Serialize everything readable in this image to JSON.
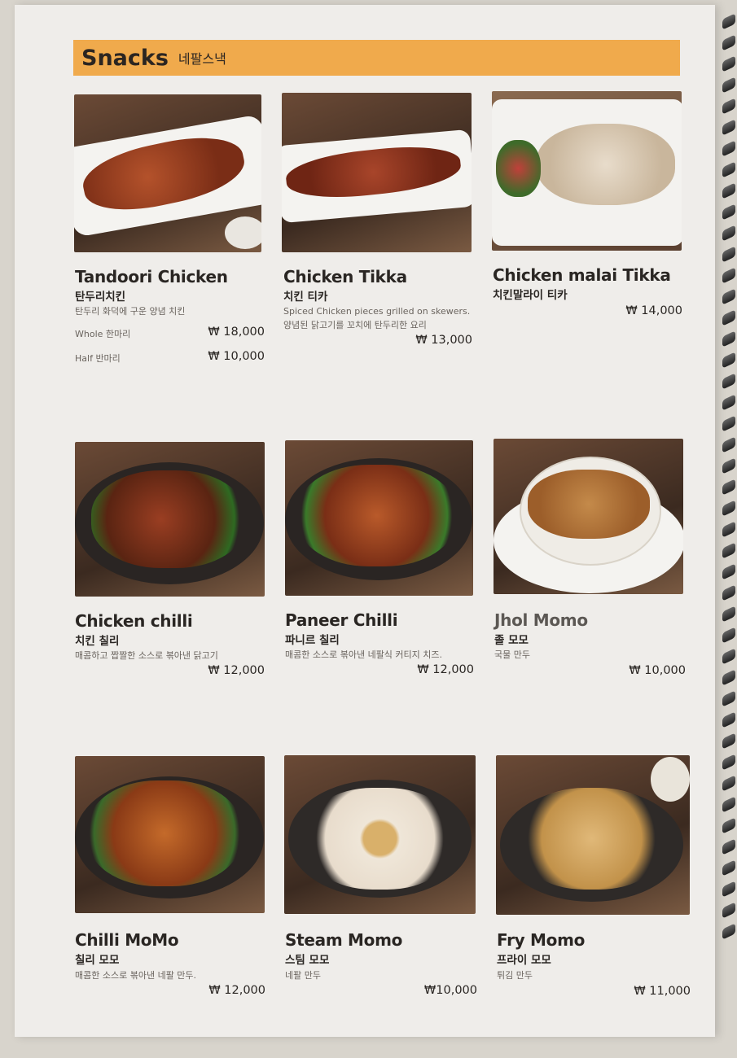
{
  "section": {
    "title": "Snacks",
    "subtitle": "네팔스낵"
  },
  "items": [
    {
      "name": "Tandoori Chicken",
      "name_ko": "탄두리치킨",
      "desc": "탄두리 화덕에 구운 양념 치킨",
      "variants": [
        {
          "label": "Whole 한마리",
          "price": "₩ 18,000"
        },
        {
          "label": "Half 반마리",
          "price": "₩ 10,000"
        }
      ]
    },
    {
      "name": "Chicken Tikka",
      "name_ko": "치킨 티카",
      "desc1": "Spiced Chicken pieces grilled on skewers.",
      "desc2": "양념된 닭고기를 꼬치에 탄두리한 요리",
      "price": "₩ 13,000"
    },
    {
      "name": "Chicken malai Tikka",
      "name_ko": "치킨말라이 티카",
      "price": "₩ 14,000"
    },
    {
      "name": "Chicken chilli",
      "name_ko": "치킨 칠리",
      "desc": "매콤하고 짭짤한 소스로 볶아낸 닭고기",
      "price": "₩ 12,000"
    },
    {
      "name": "Paneer Chilli",
      "name_ko": "파니르 칠리",
      "desc": "매콤한 소스로 볶아낸 네팔식 커티지 치즈.",
      "price": "₩ 12,000"
    },
    {
      "name": "Jhol Momo",
      "name_ko": "졸 모모",
      "desc": "국물 만두",
      "price": "₩ 10,000"
    },
    {
      "name": "Chilli MoMo",
      "name_ko": "칠리 모모",
      "desc": "매콤한 소스로 볶아낸 네팔 만두.",
      "price": "₩ 12,000"
    },
    {
      "name": "Steam  Momo",
      "name_ko": "스팀 모모",
      "desc": "네팔 만두",
      "price": "₩10,000"
    },
    {
      "name": "Fry Momo",
      "name_ko": "프라이 모모",
      "desc": "튀김 만두",
      "price": "₩ 11,000"
    }
  ]
}
